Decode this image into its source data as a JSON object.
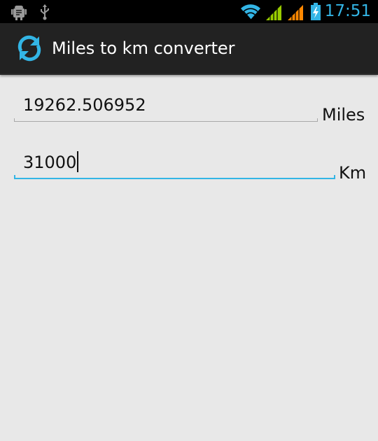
{
  "status_bar": {
    "time": "17:51",
    "icons": [
      "android-debug-icon",
      "usb-icon",
      "wifi-icon",
      "signal-green-icon",
      "signal-orange-icon",
      "battery-charging-icon"
    ]
  },
  "action_bar": {
    "title": "Miles to km converter",
    "icon": "sync-icon"
  },
  "form": {
    "miles": {
      "value": "19262.506952",
      "unit": "Miles"
    },
    "km": {
      "value": "31000",
      "unit": "Km"
    }
  },
  "colors": {
    "accent": "#33b5e5",
    "action_bar": "#222222",
    "background": "#e8e8e8",
    "signal_green": "#99cc00",
    "signal_orange": "#ff8800"
  }
}
